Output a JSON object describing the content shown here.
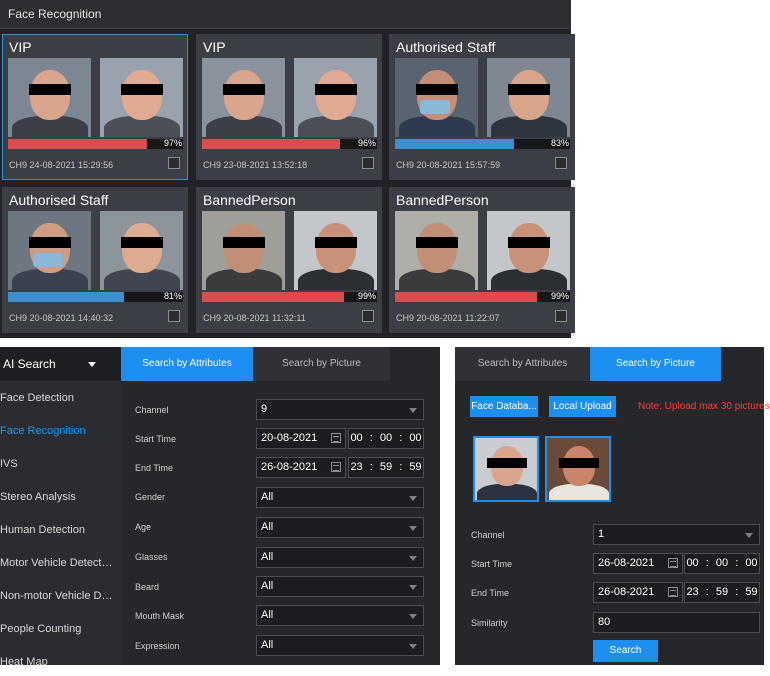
{
  "face_recognition": {
    "title": "Face Recognition",
    "cards": [
      {
        "label": "VIP",
        "similarity_pct": 97,
        "similarity_text": "97%",
        "bar_color": "#d84d4d",
        "footer": "CH9 24-08-2021 15:29:56",
        "selected": true
      },
      {
        "label": "VIP",
        "similarity_pct": 96,
        "similarity_text": "96%",
        "bar_color": "#d84d4d",
        "footer": "CH9 23-08-2021 13:52:18",
        "selected": false
      },
      {
        "label": "Authorised Staff",
        "similarity_pct": 83,
        "similarity_text": "83%",
        "bar_color": "#3f8fd0",
        "footer": "CH9 20-08-2021 15:57:59",
        "selected": false
      },
      {
        "label": "Authorised Staff",
        "similarity_pct": 81,
        "similarity_text": "81%",
        "bar_color": "#3f8fd0",
        "footer": "CH9 20-08-2021 14:40:32",
        "selected": false
      },
      {
        "label": "BannedPerson",
        "similarity_pct": 99,
        "similarity_text": "99%",
        "bar_color": "#d84d4d",
        "footer": "CH9 20-08-2021 11:32:11",
        "selected": false
      },
      {
        "label": "BannedPerson",
        "similarity_pct": 99,
        "similarity_text": "99%",
        "bar_color": "#d84d4d",
        "footer": "CH9 20-08-2021 11:22:07",
        "selected": false
      }
    ]
  },
  "ai_search": {
    "menu_title": "AI Search",
    "menu_items": [
      {
        "label": "Face Detection",
        "active": false
      },
      {
        "label": "Face Recognition",
        "active": true
      },
      {
        "label": "IVS",
        "active": false
      },
      {
        "label": "Stereo Analysis",
        "active": false
      },
      {
        "label": "Human Detection",
        "active": false
      },
      {
        "label": "Motor Vehicle Detection",
        "active": false
      },
      {
        "label": "Non-motor Vehicle Detection",
        "active": false
      },
      {
        "label": "People Counting",
        "active": false
      },
      {
        "label": "Heat Map",
        "active": false
      }
    ],
    "tabs": {
      "attributes": "Search by Attributes",
      "picture": "Search by Picture"
    },
    "fields": {
      "channel": {
        "label": "Channel",
        "value": "9"
      },
      "start_time": {
        "label": "Start Time",
        "date": "20-08-2021",
        "hh": "00",
        "mm": "00",
        "ss": "00"
      },
      "end_time": {
        "label": "End Time",
        "date": "26-08-2021",
        "hh": "23",
        "mm": "59",
        "ss": "59"
      },
      "gender": {
        "label": "Gender",
        "value": "All"
      },
      "age": {
        "label": "Age",
        "value": "All"
      },
      "glasses": {
        "label": "Glasses",
        "value": "All"
      },
      "beard": {
        "label": "Beard",
        "value": "All"
      },
      "mouth_mask": {
        "label": "Mouth Mask",
        "value": "All"
      },
      "expression": {
        "label": "Expression",
        "value": "All"
      }
    },
    "time_separator": ":"
  },
  "search_by_picture": {
    "tabs": {
      "attributes": "Search by Attributes",
      "picture": "Search by Picture"
    },
    "face_database_button": "Face Databa...",
    "local_upload_button": "Local Upload",
    "note": "Note: Upload max 30 pictures.",
    "fields": {
      "channel": {
        "label": "Channel",
        "value": "1"
      },
      "start_time": {
        "label": "Start Time",
        "date": "26-08-2021",
        "hh": "00",
        "mm": "00",
        "ss": "00"
      },
      "end_time": {
        "label": "End Time",
        "date": "26-08-2021",
        "hh": "23",
        "mm": "59",
        "ss": "59"
      },
      "similarity": {
        "label": "Similarity",
        "value": "80"
      }
    },
    "search_button": "Search"
  },
  "colors": {
    "accent": "#1d8ff0",
    "match_red": "#d84d4d",
    "match_blue": "#3f8fd0",
    "note_red": "#ff3b3b"
  }
}
